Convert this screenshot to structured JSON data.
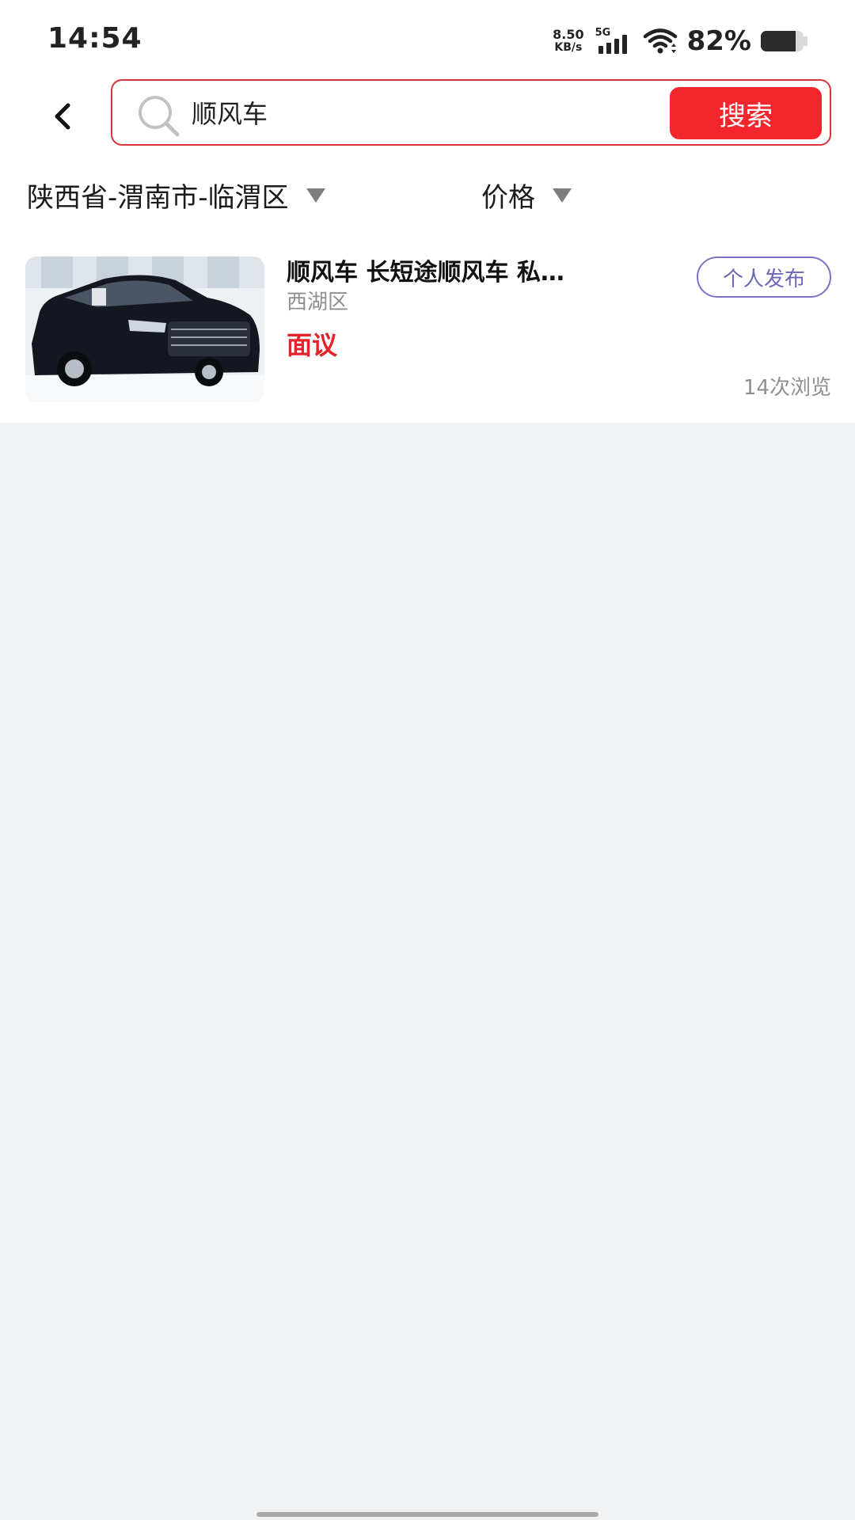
{
  "status_bar": {
    "time": "14:54",
    "net_speed_value": "8.50",
    "net_speed_unit": "KB/s",
    "network_type": "5G",
    "battery_percent": "82%",
    "battery_level": 0.82
  },
  "header": {
    "back_icon": "chevron-left-icon",
    "search": {
      "icon": "search-icon",
      "value": "顺风车",
      "button_label": "搜索",
      "border_color": "#d9343b",
      "button_color": "#f3262d"
    }
  },
  "filters": {
    "region": "陕西省-渭南市-临渭区",
    "price": "价格"
  },
  "listings": [
    {
      "title": "顺风车 长短途顺风车 私…",
      "district": "西湖区",
      "price": "面议",
      "badge": "个人发布",
      "views": "14次浏览",
      "price_color": "#e4242c",
      "badge_color": "#6d67b8"
    }
  ]
}
